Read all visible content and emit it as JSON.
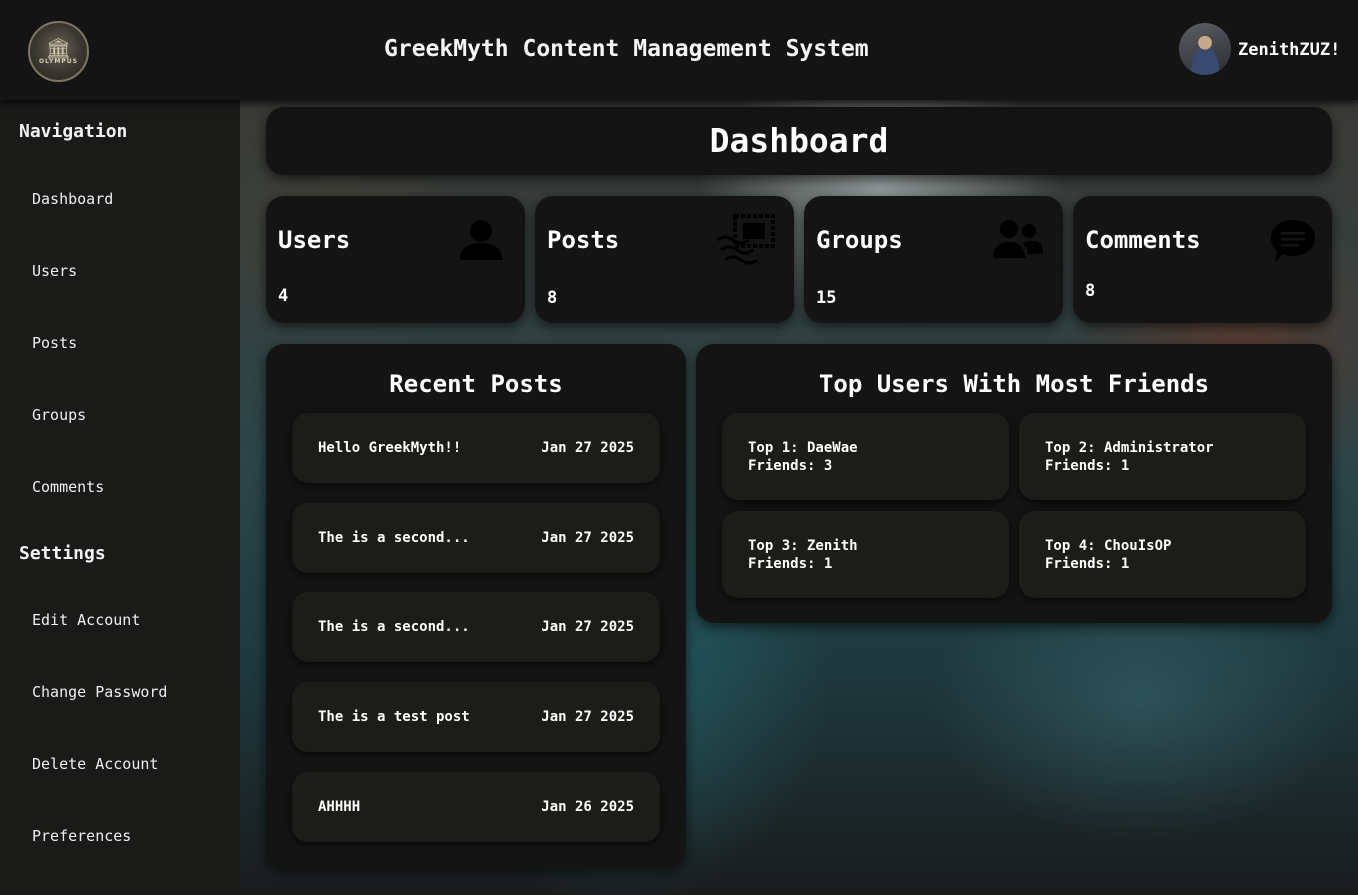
{
  "header": {
    "logo_text": "OLYMPUS",
    "title": "GreekMyth Content Management System",
    "username": "ZenithZUZ!"
  },
  "sidebar": {
    "nav_heading": "Navigation",
    "nav_items": [
      {
        "label": "Dashboard"
      },
      {
        "label": "Users"
      },
      {
        "label": "Posts"
      },
      {
        "label": "Groups"
      },
      {
        "label": "Comments"
      }
    ],
    "settings_heading": "Settings",
    "settings_items": [
      {
        "label": "Edit Account"
      },
      {
        "label": "Change Password"
      },
      {
        "label": "Delete Account"
      },
      {
        "label": "Preferences"
      }
    ]
  },
  "dashboard": {
    "title": "Dashboard",
    "stats": [
      {
        "label": "Users",
        "value": "4",
        "icon": "user-icon"
      },
      {
        "label": "Posts",
        "value": "8",
        "icon": "stamp-icon"
      },
      {
        "label": "Groups",
        "value": "15",
        "icon": "group-icon"
      },
      {
        "label": "Comments",
        "value": "8",
        "icon": "comment-icon"
      }
    ]
  },
  "recent_posts": {
    "title": "Recent Posts",
    "items": [
      {
        "title": "Hello GreekMyth!!",
        "date": "Jan 27 2025"
      },
      {
        "title": "The is a second...",
        "date": "Jan 27 2025"
      },
      {
        "title": "The is a second...",
        "date": "Jan 27 2025"
      },
      {
        "title": "The is a test post",
        "date": "Jan 27 2025"
      },
      {
        "title": "AHHHH",
        "date": "Jan 26 2025"
      }
    ]
  },
  "top_users": {
    "title": "Top Users With Most Friends",
    "items": [
      {
        "rank": "Top 1: DaeWae",
        "friends": "Friends: 3"
      },
      {
        "rank": "Top 2: Administrator",
        "friends": "Friends: 1"
      },
      {
        "rank": "Top 3: Zenith",
        "friends": "Friends: 1"
      },
      {
        "rank": "Top 4: ChouIsOP",
        "friends": "Friends: 1"
      }
    ]
  },
  "colors": {
    "panel": "#141414",
    "item": "#1c1c18",
    "sidebar": "#1a1a19",
    "text": "#ffffff"
  }
}
